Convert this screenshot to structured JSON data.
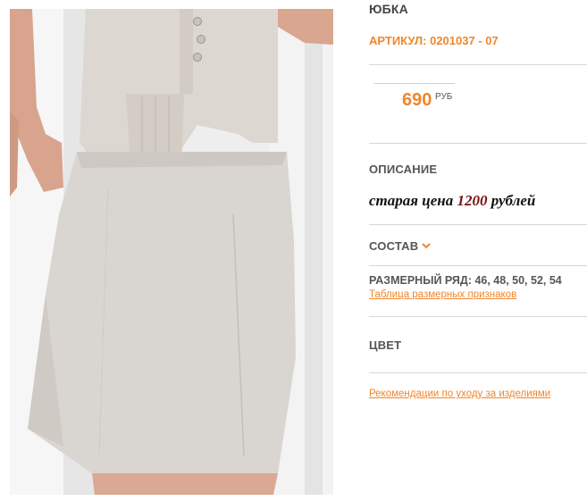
{
  "product": {
    "title": "ЮБКА",
    "sku": "АРТИКУЛ: 0201037 - 07",
    "price": "690",
    "currency": "РУБ"
  },
  "description": {
    "heading": "ОПИСАНИЕ",
    "old_price_prefix": "старая цена ",
    "old_price_value": "1200",
    "old_price_suffix": " рублей"
  },
  "composition": {
    "heading": "СОСТАВ",
    "icon": "chevron-down-icon"
  },
  "sizes": {
    "label": "РАЗМЕРНЫЙ РЯД: 46, 48, 50, 52, 54",
    "chart_link": "Таблица размерных признаков"
  },
  "color": {
    "heading": "ЦВЕТ"
  },
  "care": {
    "link": "Рекомендации по уходу за изделиями"
  },
  "colors": {
    "accent": "#f0862b",
    "old_price_number": "#7a1111",
    "separator": "#d7d7d7"
  }
}
